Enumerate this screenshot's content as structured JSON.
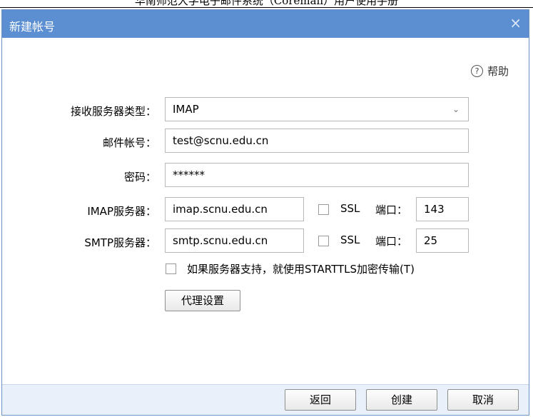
{
  "doc_header": "华南师范大学电子邮件系统（Coremail）用户使用手册",
  "dialog": {
    "title": "新建帐号",
    "close": "×"
  },
  "help": {
    "icon": "?",
    "label": "帮助"
  },
  "form": {
    "server_type_label": "接收服务器类型：",
    "server_type_value": "IMAP",
    "account_label": "邮件帐号：",
    "account_value": "test@scnu.edu.cn",
    "password_label": "密码：",
    "password_value": "******",
    "imap_label": "IMAP服务器：",
    "imap_value": "imap.scnu.edu.cn",
    "imap_ssl": "SSL",
    "imap_port_label": "端口：",
    "imap_port_value": "143",
    "smtp_label": "SMTP服务器：",
    "smtp_value": "smtp.scnu.edu.cn",
    "smtp_ssl": "SSL",
    "smtp_port_label": "端口：",
    "smtp_port_value": "25",
    "starttls_label": "如果服务器支持，就使用STARTTLS加密传输(T)",
    "proxy_button": "代理设置"
  },
  "footer": {
    "back": "返回",
    "create": "创建",
    "cancel": "取消"
  }
}
